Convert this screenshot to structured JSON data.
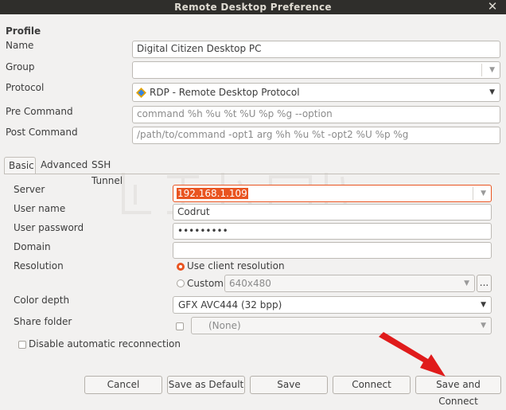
{
  "window": {
    "title": "Remote Desktop Preference"
  },
  "profile": {
    "section_label": "Profile",
    "name_label": "Name",
    "name_value": "Digital Citizen Desktop PC",
    "group_label": "Group",
    "group_value": "",
    "protocol_label": "Protocol",
    "protocol_value": "RDP - Remote Desktop Protocol",
    "pre_command_label": "Pre Command",
    "pre_command_placeholder": "command %h %u %t %U %p %g --option",
    "post_command_label": "Post Command",
    "post_command_placeholder": "/path/to/command -opt1 arg %h %u %t -opt2 %U %p %g"
  },
  "tabs": [
    {
      "label": "Basic"
    },
    {
      "label": "Advanced"
    },
    {
      "label": "SSH Tunnel"
    }
  ],
  "basic": {
    "server_label": "Server",
    "server_value": "192.168.1.109",
    "user_name_label": "User name",
    "user_name_value": "Codrut",
    "password_label": "User password",
    "password_value": "•••••••••",
    "domain_label": "Domain",
    "domain_value": "",
    "resolution_label": "Resolution",
    "use_client_resolution_label": "Use client resolution",
    "custom_label": "Custom",
    "custom_value": "640x480",
    "custom_more_label": "...",
    "color_depth_label": "Color depth",
    "color_depth_value": "GFX AVC444 (32 bpp)",
    "share_folder_label": "Share folder",
    "share_folder_value": "(None)",
    "disable_reconnect_label": "Disable automatic reconnection"
  },
  "buttons": {
    "cancel": "Cancel",
    "save_default": "Save as Default",
    "save": "Save",
    "connect": "Connect",
    "save_connect": "Save and Connect"
  },
  "colors": {
    "accent": "#e95420",
    "arrow": "#e01b1b"
  }
}
